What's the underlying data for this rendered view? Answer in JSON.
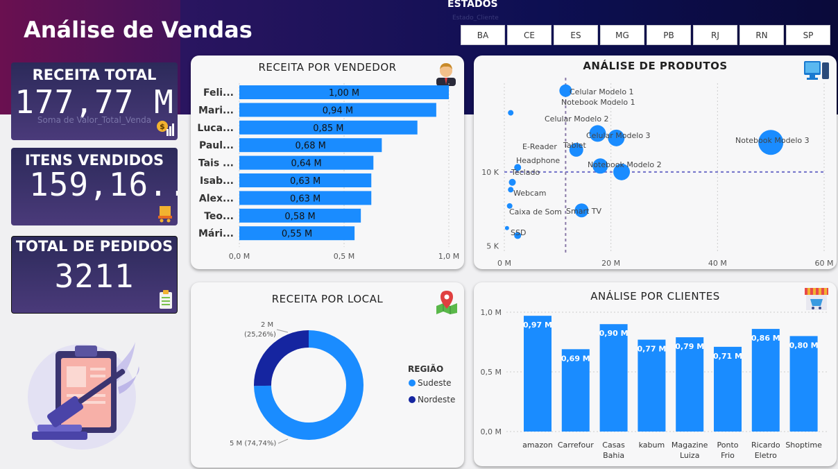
{
  "header": {
    "title": "Análise de Vendas",
    "states_title": "ESTADOS",
    "states_subtitle": "Estado_Cliente",
    "states": [
      "BA",
      "CE",
      "ES",
      "MG",
      "PB",
      "RJ",
      "RN",
      "SP"
    ]
  },
  "kpis": {
    "receita": {
      "label": "RECEITA TOTAL",
      "value": "177,77 M",
      "sub": "Soma de Valor_Total_Venda",
      "icon": "money-chart-icon"
    },
    "itens": {
      "label": "ITENS VENDIDOS",
      "value": "159,16...",
      "icon": "cart-icon"
    },
    "pedidos": {
      "label": "TOTAL DE PEDIDOS",
      "value": "3211",
      "icon": "clipboard-icon"
    }
  },
  "cards": {
    "vendedor_title": "RECEITA POR VENDEDOR",
    "produtos_title": "ANÁLISE DE PRODUTOS",
    "local_title": "RECEITA POR LOCAL",
    "clientes_title": "ANÁLISE POR CLIENTES"
  },
  "colors": {
    "primary": "#1a8cff",
    "dark": "#1525a0",
    "header_dark": "#0d0f52",
    "header_magenta": "#6a1050"
  },
  "chart_data": [
    {
      "id": "vendedor",
      "type": "bar",
      "orientation": "horizontal",
      "categories": [
        "Feli...",
        "Mari...",
        "Luca...",
        "Paul...",
        "Tais ...",
        "Isab...",
        "Alex...",
        "Teo...",
        "Mári..."
      ],
      "values": [
        1.0,
        0.94,
        0.85,
        0.68,
        0.64,
        0.63,
        0.63,
        0.58,
        0.55
      ],
      "data_labels": [
        "1,00 M",
        "0,94 M",
        "0,85 M",
        "0,68 M",
        "0,64 M",
        "0,63 M",
        "0,63 M",
        "0,58 M",
        "0,55 M"
      ],
      "xlim": [
        0,
        1.0
      ],
      "xticks": [
        0,
        0.5,
        1.0
      ],
      "xtick_labels": [
        "0,0 M",
        "0,5 M",
        "1,0 M"
      ]
    },
    {
      "id": "produtos",
      "type": "scatter",
      "points": [
        {
          "name": "",
          "x": 1.2,
          "y": 14000,
          "size": 4
        },
        {
          "name": "Celular Modelo 1",
          "x": 11.5,
          "y": 15500,
          "size": 9
        },
        {
          "name": "Notebook Modelo 1",
          "x": 17.5,
          "y": 12600,
          "size": 12
        },
        {
          "name": "Celular Modelo 2",
          "x": 21,
          "y": 12300,
          "size": 12
        },
        {
          "name": "Notebook Modelo 3",
          "x": 50,
          "y": 12000,
          "size": 18
        },
        {
          "name": "Tablet",
          "x": 13.5,
          "y": 11500,
          "size": 10
        },
        {
          "name": "Celular Modelo 3",
          "x": 18,
          "y": 10400,
          "size": 11
        },
        {
          "name": "Notebook Modelo 2",
          "x": 22,
          "y": 10000,
          "size": 12
        },
        {
          "name": "E-Reader",
          "x": 2.5,
          "y": 10300,
          "size": 5
        },
        {
          "name": "Headphone",
          "x": 1.5,
          "y": 9300,
          "size": 5
        },
        {
          "name": "Teclado",
          "x": 1.2,
          "y": 8800,
          "size": 4
        },
        {
          "name": "Webcam",
          "x": 1.0,
          "y": 7700,
          "size": 4
        },
        {
          "name": "Smart TV",
          "x": 14.5,
          "y": 7400,
          "size": 10
        },
        {
          "name": "Caixa de Som",
          "x": 0.5,
          "y": 6200,
          "size": 3
        },
        {
          "name": "SSD",
          "x": 2.5,
          "y": 5700,
          "size": 5
        }
      ],
      "xlim": [
        0,
        60
      ],
      "ylim": [
        4500,
        16000
      ],
      "xticks": [
        0,
        20,
        40,
        60
      ],
      "xtick_labels": [
        "0 M",
        "20 M",
        "40 M",
        "60 M"
      ],
      "yticks": [
        5000,
        10000
      ],
      "ytick_labels": [
        "5 K",
        "10 K"
      ],
      "avg_x": 11.5,
      "avg_y": 10000
    },
    {
      "id": "local",
      "type": "pie",
      "donut": true,
      "legend_title": "REGIÃO",
      "legend_position": "right",
      "slices": [
        {
          "name": "Sudeste",
          "value": 74.74,
          "label_value": "5 M",
          "label_pct": "(74,74%)",
          "color": "#1a8cff"
        },
        {
          "name": "Nordeste",
          "value": 25.26,
          "label_value": "2 M",
          "label_pct": "(25,26%)",
          "color": "#1525a0"
        }
      ]
    },
    {
      "id": "clientes",
      "type": "bar",
      "categories": [
        "amazon",
        "Carrefour",
        "Casas Bahia",
        "kabum",
        "Magazine Luiza",
        "Ponto Frio",
        "Ricardo Eletro",
        "Shoptime"
      ],
      "category_lines": [
        [
          "amazon"
        ],
        [
          "Carrefour"
        ],
        [
          "Casas",
          "Bahia"
        ],
        [
          "kabum"
        ],
        [
          "Magazine",
          "Luiza"
        ],
        [
          "Ponto",
          "Frio"
        ],
        [
          "Ricardo",
          "Eletro"
        ],
        [
          "Shoptime"
        ]
      ],
      "values": [
        0.97,
        0.69,
        0.9,
        0.77,
        0.79,
        0.71,
        0.86,
        0.8
      ],
      "data_labels": [
        "0,97 M",
        "0,69 M",
        "0,90 M",
        "0,77 M",
        "0,79 M",
        "0,71 M",
        "0,86 M",
        "0,80 M"
      ],
      "ylim": [
        0,
        1.0
      ],
      "yticks": [
        0,
        0.5,
        1.0
      ],
      "ytick_labels": [
        "0,0 M",
        "0,5 M",
        "1,0 M"
      ]
    }
  ]
}
